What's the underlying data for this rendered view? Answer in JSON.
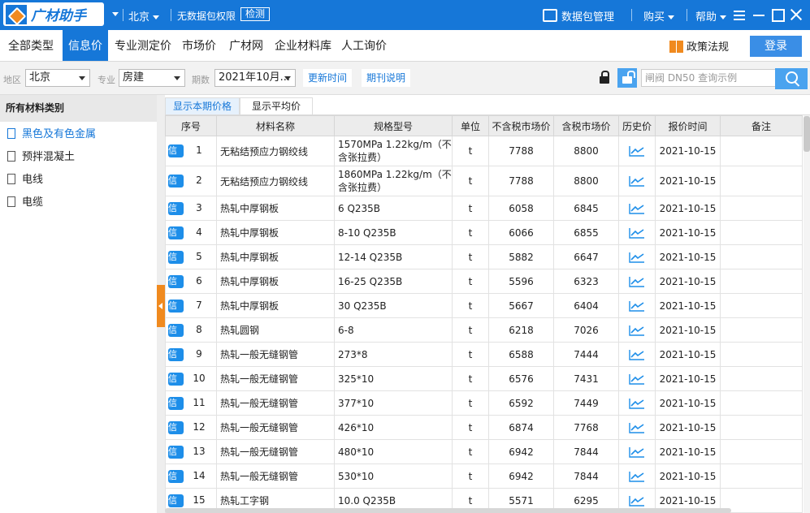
{
  "app": {
    "logo": "广材助手",
    "city": "北京",
    "no_perm": "无数据包权限",
    "check": "检测"
  },
  "topbar": {
    "pkg": "数据包管理",
    "buy": "购买",
    "help": "帮助"
  },
  "nav": {
    "tabs": [
      "全部类型",
      "信息价",
      "专业测定价",
      "市场价",
      "广材网",
      "企业材料库",
      "人工询价"
    ],
    "active": "信息价",
    "policy": "政策法规",
    "login": "登录"
  },
  "filters": {
    "region_label": "地区",
    "region": "北京",
    "major_label": "专业",
    "major": "房建",
    "period_label": "期数",
    "period": "2021年10月...",
    "update_btn": "更新时间",
    "period_btn": "期刊说明",
    "search_placeholder": "闸阀 DN50 查询示例"
  },
  "sidebar": {
    "title": "所有材料类别",
    "items": [
      "黑色及有色金属",
      "预拌混凝土",
      "电线",
      "电缆"
    ]
  },
  "subtabs": [
    "显示本期价格",
    "显示平均价"
  ],
  "table": {
    "headers": [
      "序号",
      "材料名称",
      "规格型号",
      "单位",
      "不含税市场价",
      "含税市场价",
      "历史价",
      "报价时间",
      "备注"
    ],
    "badge": "信",
    "rows": [
      {
        "no": "1",
        "name": "无粘结预应力钢绞线",
        "spec": "1570MPa 1.22kg/m（不含张拉费）",
        "unit": "t",
        "ex": "7788",
        "inc": "8800",
        "date": "2021-10-15",
        "note": ""
      },
      {
        "no": "2",
        "name": "无粘结预应力钢绞线",
        "spec": "1860MPa 1.22kg/m（不含张拉费）",
        "unit": "t",
        "ex": "7788",
        "inc": "8800",
        "date": "2021-10-15",
        "note": ""
      },
      {
        "no": "3",
        "name": "热轧中厚钢板",
        "spec": "6 Q235B",
        "unit": "t",
        "ex": "6058",
        "inc": "6845",
        "date": "2021-10-15",
        "note": ""
      },
      {
        "no": "4",
        "name": "热轧中厚钢板",
        "spec": "8-10 Q235B",
        "unit": "t",
        "ex": "6066",
        "inc": "6855",
        "date": "2021-10-15",
        "note": ""
      },
      {
        "no": "5",
        "name": "热轧中厚钢板",
        "spec": "12-14 Q235B",
        "unit": "t",
        "ex": "5882",
        "inc": "6647",
        "date": "2021-10-15",
        "note": ""
      },
      {
        "no": "6",
        "name": "热轧中厚钢板",
        "spec": "16-25 Q235B",
        "unit": "t",
        "ex": "5596",
        "inc": "6323",
        "date": "2021-10-15",
        "note": ""
      },
      {
        "no": "7",
        "name": "热轧中厚钢板",
        "spec": "30 Q235B",
        "unit": "t",
        "ex": "5667",
        "inc": "6404",
        "date": "2021-10-15",
        "note": ""
      },
      {
        "no": "8",
        "name": "热轧圆钢",
        "spec": "6-8",
        "unit": "t",
        "ex": "6218",
        "inc": "7026",
        "date": "2021-10-15",
        "note": ""
      },
      {
        "no": "9",
        "name": "热轧一般无缝钢管",
        "spec": "273*8",
        "unit": "t",
        "ex": "6588",
        "inc": "7444",
        "date": "2021-10-15",
        "note": ""
      },
      {
        "no": "10",
        "name": "热轧一般无缝钢管",
        "spec": "325*10",
        "unit": "t",
        "ex": "6576",
        "inc": "7431",
        "date": "2021-10-15",
        "note": ""
      },
      {
        "no": "11",
        "name": "热轧一般无缝钢管",
        "spec": "377*10",
        "unit": "t",
        "ex": "6592",
        "inc": "7449",
        "date": "2021-10-15",
        "note": ""
      },
      {
        "no": "12",
        "name": "热轧一般无缝钢管",
        "spec": "426*10",
        "unit": "t",
        "ex": "6874",
        "inc": "7768",
        "date": "2021-10-15",
        "note": ""
      },
      {
        "no": "13",
        "name": "热轧一般无缝钢管",
        "spec": "480*10",
        "unit": "t",
        "ex": "6942",
        "inc": "7844",
        "date": "2021-10-15",
        "note": ""
      },
      {
        "no": "14",
        "name": "热轧一般无缝钢管",
        "spec": "530*10",
        "unit": "t",
        "ex": "6942",
        "inc": "7844",
        "date": "2021-10-15",
        "note": ""
      },
      {
        "no": "15",
        "name": "热轧工字钢",
        "spec": "10.0 Q235B",
        "unit": "t",
        "ex": "5571",
        "inc": "6295",
        "date": "2021-10-15",
        "note": ""
      }
    ]
  },
  "colors": {
    "brand": "#1677d8",
    "accent": "#f08a1f"
  }
}
